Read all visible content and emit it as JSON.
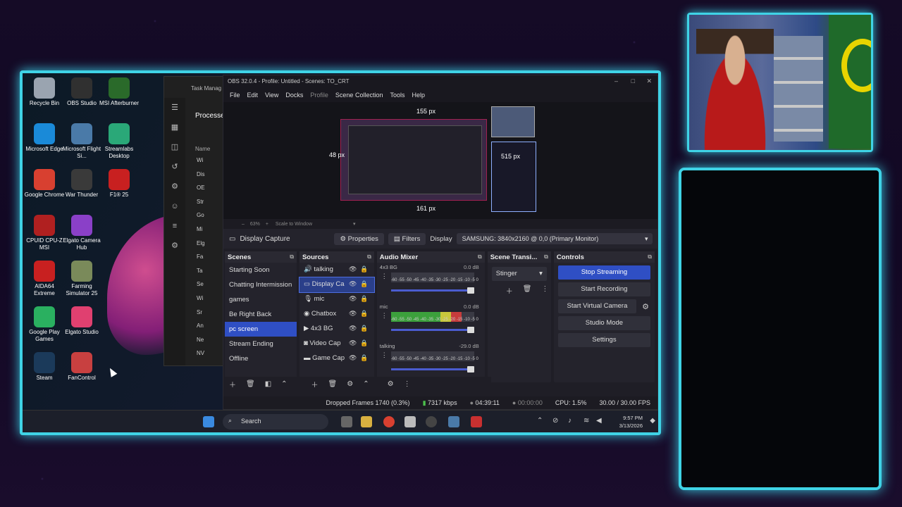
{
  "desktop_icons": [
    {
      "label": "Recycle Bin",
      "color": "#9aa4b0"
    },
    {
      "label": "OBS Studio",
      "color": "#303030"
    },
    {
      "label": "MSI Afterburner",
      "color": "#2a6a2a"
    },
    {
      "label": "Microsoft Edge",
      "color": "#1a8ad8"
    },
    {
      "label": "Microsoft Flight Si...",
      "color": "#4a7aa8"
    },
    {
      "label": "Streamlabs Desktop",
      "color": "#2aa878"
    },
    {
      "label": "Google Chrome",
      "color": "#d84030"
    },
    {
      "label": "War Thunder",
      "color": "#3a3a3a"
    },
    {
      "label": "F1® 25",
      "color": "#c82020"
    },
    {
      "label": "CPUID CPU-Z MSI",
      "color": "#b02020"
    },
    {
      "label": "Elgato Camera Hub",
      "color": "#8a40c8"
    },
    {
      "label": "AIDA64 Extreme",
      "color": "#c82020"
    },
    {
      "label": "Farming Simulator 25",
      "color": "#7a8a5a"
    },
    {
      "label": "Google Play Games",
      "color": "#2ab060"
    },
    {
      "label": "Elgato Studio",
      "color": "#e04070"
    },
    {
      "label": "Steam",
      "color": "#1b3a5a"
    },
    {
      "label": "FanControl",
      "color": "#c84040"
    }
  ],
  "task_manager": {
    "title": "Task Manag",
    "section": "Processe",
    "column": "Name",
    "rows": [
      "Wi",
      "Dis",
      "OE",
      "Str",
      "Go",
      "Mi",
      "Elg",
      "Fa",
      "Ta",
      "Se",
      "Wi",
      "Sr",
      "An",
      "Ne",
      "NV"
    ]
  },
  "obs": {
    "title": "OBS 32.0.4 - Profile: Untitled - Scenes: TO_CRT",
    "menu": [
      "File",
      "Edit",
      "View",
      "Docks",
      "Profile",
      "Scene Collection",
      "Tools",
      "Help"
    ],
    "preview_labels": {
      "top": "155 px",
      "left": "48 px",
      "right": "515 px",
      "bottom": "161 px"
    },
    "zoom": "63%",
    "zoom_mode": "Scale to Window",
    "source_bar": {
      "source": "Display Capture",
      "properties": "Properties",
      "filters": "Filters",
      "display_label": "Display",
      "display_value": "SAMSUNG: 3840x2160 @ 0,0 (Primary Monitor)"
    },
    "scenes_title": "Scenes",
    "scenes": [
      "Starting Soon",
      "Chatting Intermission",
      "games",
      "Be Right Back",
      "pc screen",
      "Stream Ending",
      "Offline"
    ],
    "active_scene": "pc screen",
    "sources_title": "Sources",
    "sources": [
      "talking",
      "Display Ca",
      "mic",
      "Chatbox",
      "4x3 BG",
      "Video Cap",
      "Game Cap"
    ],
    "mixer_title": "Audio Mixer",
    "mixer": [
      {
        "name": "4x3 BG",
        "db": "0.0 dB",
        "level": 0
      },
      {
        "name": "mic",
        "db": "0.0 dB",
        "level": 0.85
      },
      {
        "name": "talking",
        "db": "-29.0 dB",
        "level": 0
      }
    ],
    "meter_scale": "-60 -55 -50 -45 -40 -35 -30 -25 -20 -15 -10 -5 0",
    "transitions_title": "Scene Transi...",
    "transition": "Stinger",
    "controls_title": "Controls",
    "controls": [
      "Stop Streaming",
      "Start Recording",
      "Start Virtual Camera",
      "Studio Mode",
      "Settings"
    ],
    "status": {
      "dropped": "Dropped Frames 1740 (0.3%)",
      "bitrate": "7317 kbps",
      "live": "04:39:11",
      "rec": "00:00:00",
      "cpu": "CPU: 1.5%",
      "fps": "30.00 / 30.00 FPS"
    }
  },
  "taskbar": {
    "search": "Search",
    "time": "9:57 PM",
    "date": "3/13/2026"
  },
  "colors": {
    "neon": "#3fd3e6",
    "accent": "#2f4fc4",
    "obs_bg": "#1f1e26"
  }
}
